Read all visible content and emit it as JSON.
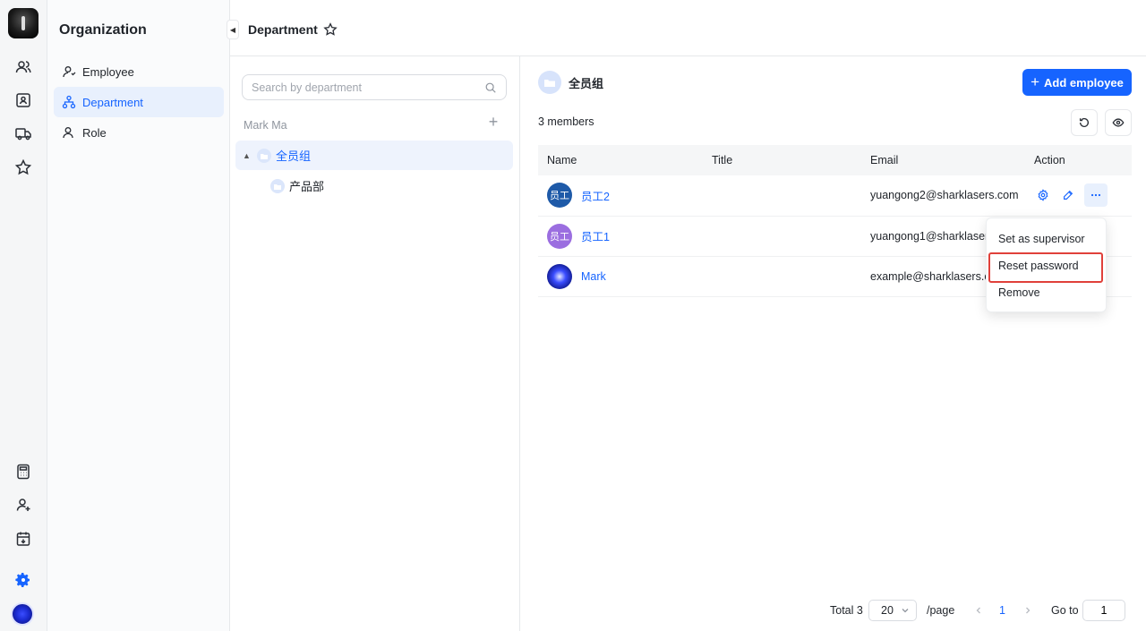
{
  "org_panel": {
    "title": "Organization",
    "items": [
      {
        "label": "Employee",
        "icon": "user-icon"
      },
      {
        "label": "Department",
        "icon": "org-chart-icon",
        "active": true
      },
      {
        "label": "Role",
        "icon": "role-icon"
      }
    ]
  },
  "topbar": {
    "title": "Department"
  },
  "tree": {
    "search_placeholder": "Search by department",
    "owner": "Mark Ma",
    "nodes": [
      {
        "label": "全员组",
        "expanded": true,
        "active": true
      },
      {
        "label": "产品部"
      }
    ]
  },
  "main": {
    "dept_name": "全员组",
    "add_button": "Add employee",
    "members_count": "3 members",
    "columns": [
      "Name",
      "Title",
      "Email",
      "Action"
    ],
    "rows": [
      {
        "avatar_text": "员工",
        "avatar_color": "#1e5aa8",
        "name": "员工2",
        "title": "",
        "email": "yuangong2@sharklasers.com"
      },
      {
        "avatar_text": "员工",
        "avatar_color": "#9b6ee0",
        "name": "员工1",
        "title": "",
        "email": "yuangong1@sharklasers"
      },
      {
        "avatar_text": "",
        "avatar_color": "#3a4dff",
        "name": "Mark",
        "title": "",
        "email": "example@sharklasers.co"
      }
    ]
  },
  "menu": {
    "items": [
      "Set as supervisor",
      "Reset password",
      "Remove"
    ],
    "highlighted": "Reset password"
  },
  "pagination": {
    "total": "Total 3",
    "page_size": "20",
    "per_page": "/page",
    "current": "1",
    "goto_label": "Go to",
    "goto_value": "1"
  },
  "colors": {
    "accent": "#1664ff",
    "highlight_border": "#e0403a"
  }
}
